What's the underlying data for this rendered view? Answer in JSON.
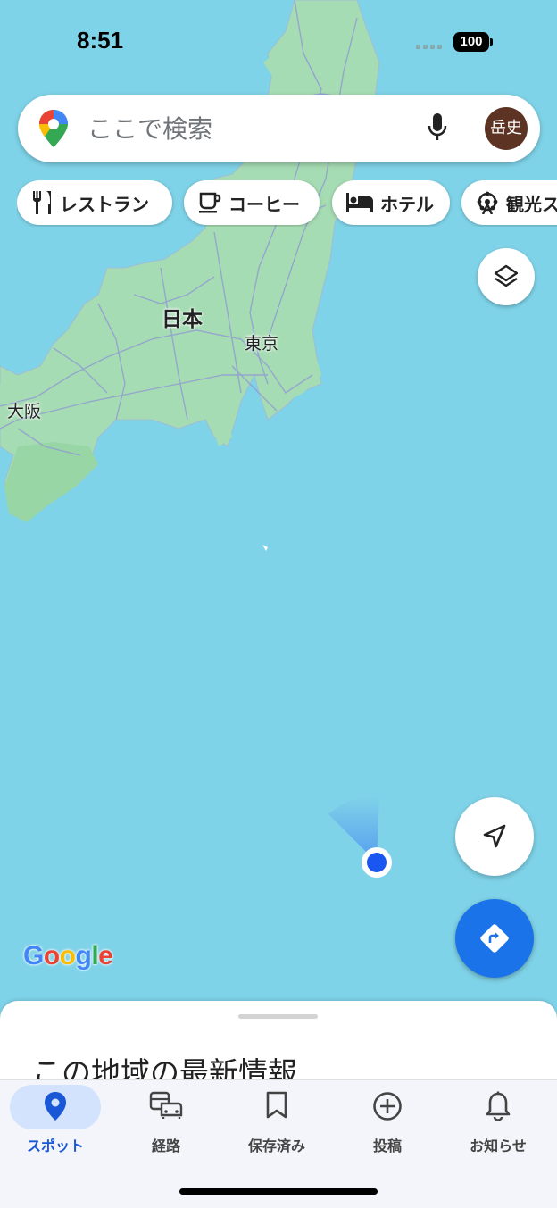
{
  "status_bar": {
    "time": "8:51",
    "battery": "100"
  },
  "search": {
    "placeholder": "ここで検索",
    "avatar_text": "岳史"
  },
  "chips": [
    {
      "label": "レストラン",
      "icon": "fork-knife-icon"
    },
    {
      "label": "コーヒー",
      "icon": "coffee-cup-icon"
    },
    {
      "label": "ホテル",
      "icon": "bed-icon"
    },
    {
      "label": "観光ス",
      "icon": "ferris-wheel-icon"
    }
  ],
  "map": {
    "labels": {
      "country": "日本",
      "tokyo": "東京",
      "osaka": "大阪"
    },
    "water_color": "#7fd3e8",
    "land_color": "#a6dcb3"
  },
  "google_logo": "Google",
  "sheet": {
    "title": "この地域の最新情報"
  },
  "nav": [
    {
      "label": "スポット",
      "icon": "location-pin-icon",
      "active": true
    },
    {
      "label": "経路",
      "icon": "commute-icon",
      "active": false
    },
    {
      "label": "保存済み",
      "icon": "bookmark-icon",
      "active": false
    },
    {
      "label": "投稿",
      "icon": "add-circle-icon",
      "active": false
    },
    {
      "label": "お知らせ",
      "icon": "bell-icon",
      "active": false
    }
  ],
  "colors": {
    "accent": "#1a73e8",
    "active_pill": "#d3e3fd"
  }
}
